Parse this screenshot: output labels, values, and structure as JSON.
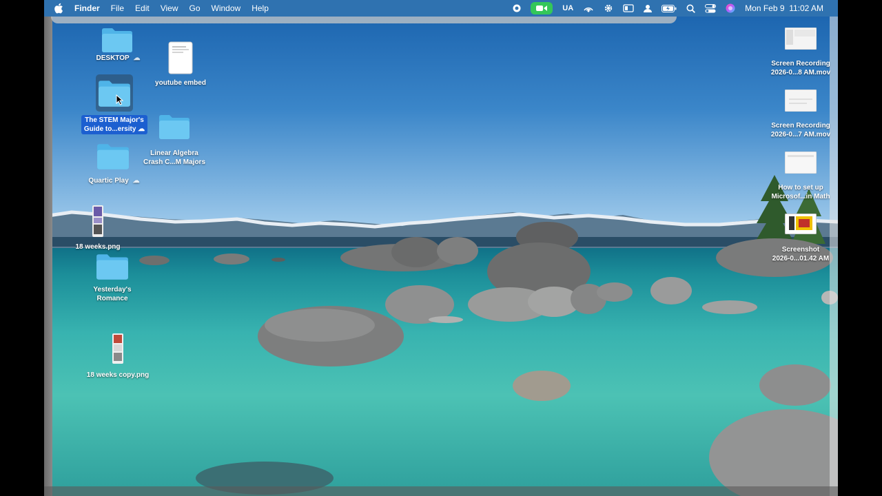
{
  "menubar": {
    "app_name": "Finder",
    "menus": [
      "File",
      "Edit",
      "View",
      "Go",
      "Window",
      "Help"
    ],
    "status": {
      "input_source": "UA",
      "datetime": "Mon Feb 9  11:02 AM"
    },
    "status_icons": [
      "record-icon",
      "facetime-icon",
      "input-source",
      "airdrop-icon",
      "gear-icon",
      "display-icon",
      "user-icon",
      "battery-icon",
      "search-icon",
      "control-center-icon",
      "siri-icon"
    ]
  },
  "desktop": {
    "left_icons": [
      {
        "name": "DESKTOP",
        "type": "folder",
        "icloud": true
      },
      {
        "name": "youtube embed",
        "type": "document"
      },
      {
        "name_line1": "The STEM Major's",
        "name_line2": "Guide to...ersity",
        "type": "folder",
        "selected": true,
        "icloud": true
      },
      {
        "name_line1": "Linear Algebra",
        "name_line2": "Crash C...M Majors",
        "type": "folder"
      },
      {
        "name": "Quartic Play",
        "type": "folder",
        "icloud": true
      },
      {
        "name": "18 weeks.png",
        "type": "image"
      },
      {
        "name_line1": "Yesterday's",
        "name_line2": "Romance",
        "type": "folder"
      },
      {
        "name": "18 weeks copy.png",
        "type": "image"
      }
    ],
    "right_icons": [
      {
        "name_line1": "Screen Recording",
        "name_line2": "2026-0...8 AM.mov"
      },
      {
        "name_line1": "Screen Recording",
        "name_line2": "2026-0...7 AM.mov"
      },
      {
        "name_line1": "How to set up",
        "name_line2": "Microsof...in Math"
      },
      {
        "name_line1": "Screenshot",
        "name_line2": "2026-0...01.42 AM"
      }
    ]
  },
  "colors": {
    "menubar": "#2f72b0",
    "folder": "#5fc0ee",
    "selection": "#1c5fd0",
    "facetime": "#34c759"
  }
}
